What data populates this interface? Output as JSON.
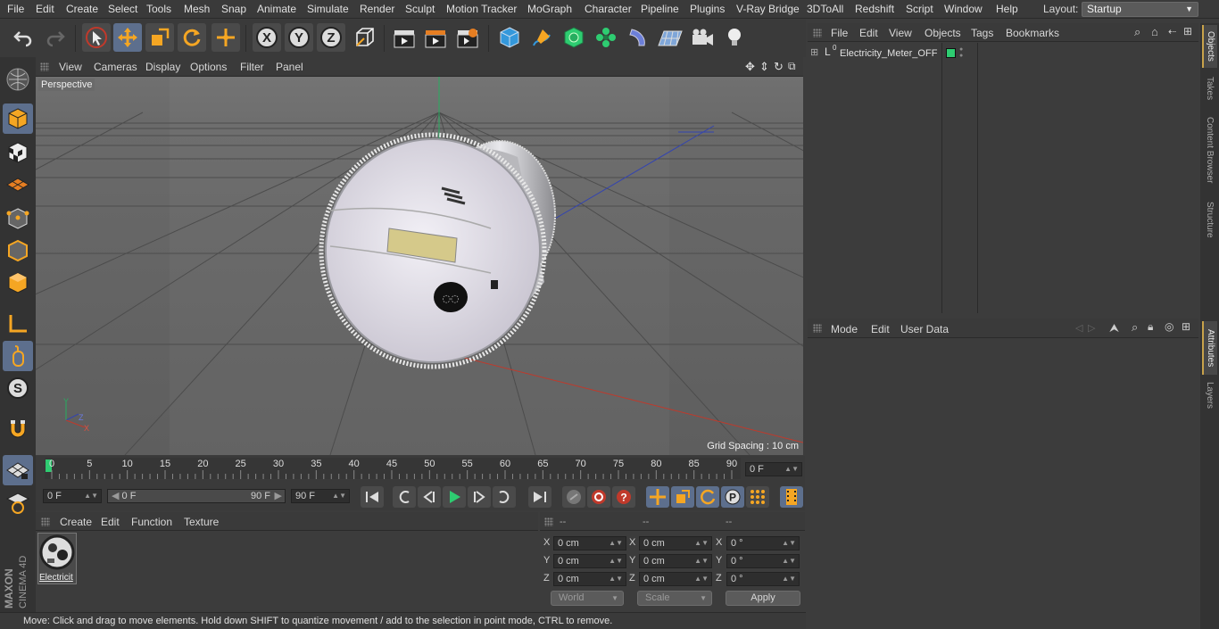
{
  "menubar": {
    "items": [
      "File",
      "Edit",
      "Create",
      "Select",
      "Tools",
      "Mesh",
      "Snap",
      "Animate",
      "Simulate",
      "Render",
      "Sculpt",
      "Motion Tracker",
      "MoGraph",
      "Character",
      "Pipeline",
      "Plugins",
      "V-Ray Bridge",
      "3DToAll",
      "Redshift",
      "Script",
      "Window",
      "Help"
    ],
    "layout_label": "Layout:",
    "layout_value": "Startup"
  },
  "viewport": {
    "menu": [
      "View",
      "Cameras",
      "Display",
      "Options",
      "Filter",
      "Panel"
    ],
    "camera_label": "Perspective",
    "grid_spacing": "Grid Spacing : 10 cm"
  },
  "timeline": {
    "ticks": [
      "0",
      "5",
      "10",
      "15",
      "20",
      "25",
      "30",
      "35",
      "40",
      "45",
      "50",
      "55",
      "60",
      "65",
      "70",
      "75",
      "80",
      "85",
      "90"
    ],
    "current_frame": "0 F",
    "start_field": "0 F",
    "range_start": "0 F",
    "range_end": "90 F",
    "end_field": "90 F"
  },
  "materials": {
    "menu": [
      "Create",
      "Edit",
      "Function",
      "Texture"
    ],
    "item_label": "Electricit"
  },
  "coords": {
    "head": [
      "--",
      "--",
      "--"
    ],
    "rows": [
      {
        "a": "X",
        "av": "0 cm",
        "b": "X",
        "bv": "0 cm",
        "c": "X",
        "cv": "0 °"
      },
      {
        "a": "Y",
        "av": "0 cm",
        "b": "Y",
        "bv": "0 cm",
        "c": "Y",
        "cv": "0 °"
      },
      {
        "a": "Z",
        "av": "0 cm",
        "b": "Z",
        "bv": "0 cm",
        "c": "Z",
        "cv": "0 °"
      }
    ],
    "world": "World",
    "scale": "Scale",
    "apply": "Apply"
  },
  "objects": {
    "menu": [
      "File",
      "Edit",
      "View",
      "Objects",
      "Tags",
      "Bookmarks"
    ],
    "item": "Electricity_Meter_OFF",
    "tag_color": "#2ecc71"
  },
  "attributes": {
    "menu": [
      "Mode",
      "Edit",
      "User Data"
    ]
  },
  "right_tabs": [
    "Objects",
    "Takes",
    "Content Browser",
    "Structure",
    "Attributes",
    "Layers"
  ],
  "status": "Move: Click and drag to move elements. Hold down SHIFT to quantize movement / add to the selection in point mode, CTRL to remove.",
  "brand": {
    "line1": "MAXON",
    "line2": "CINEMA 4D"
  },
  "colors": {
    "accent": "#5d6f8d",
    "x_axis": "#c0392b",
    "y_axis": "#27ae60",
    "z_axis": "#2c3e9e"
  }
}
